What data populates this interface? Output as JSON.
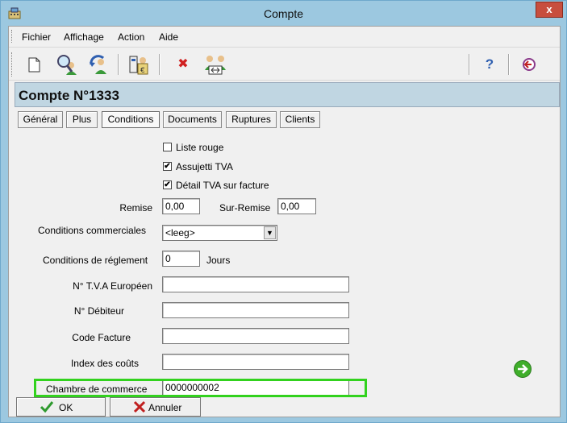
{
  "window": {
    "title": "Compte",
    "close_glyph": "x"
  },
  "menu": {
    "items": [
      "Fichier",
      "Affichage",
      "Action",
      "Aide"
    ]
  },
  "toolbar": {
    "icons": [
      "new-document-icon",
      "search-user-icon",
      "refresh-user-icon",
      "document-euro-icon",
      "delete-icon",
      "transfer-users-icon",
      "help-icon",
      "exit-icon"
    ],
    "help_glyph": "?",
    "delete_glyph": "✖"
  },
  "header": {
    "title": "Compte N°1333"
  },
  "tabs": [
    {
      "label": "Général"
    },
    {
      "label": "Plus"
    },
    {
      "label": "Conditions"
    },
    {
      "label": "Documents"
    },
    {
      "label": "Ruptures"
    },
    {
      "label": "Clients"
    }
  ],
  "active_tab": "Conditions",
  "form": {
    "liste_rouge": {
      "label": "Liste rouge",
      "checked": false
    },
    "assujetti_tva": {
      "label": "Assujetti TVA",
      "checked": true,
      "mark": "✔"
    },
    "detail_tva": {
      "label": "Détail TVA sur facture",
      "checked": true,
      "mark": "✔"
    },
    "remise": {
      "label": "Remise",
      "value": "0,00"
    },
    "sur_remise": {
      "label": "Sur-Remise",
      "value": "0,00"
    },
    "conditions_commerciales": {
      "label": "Conditions commerciales",
      "value": "<leeg>",
      "arrow": "▼"
    },
    "conditions_reglement": {
      "label": "Conditions de réglement",
      "value": "0",
      "unit": "Jours"
    },
    "tva_europeen": {
      "label": "N° T.V.A Européen",
      "value": ""
    },
    "debiteur": {
      "label": "N° Débiteur",
      "value": ""
    },
    "code_facture": {
      "label": "Code Facture",
      "value": ""
    },
    "index_couts": {
      "label": "Index des coûts",
      "value": ""
    },
    "chambre_commerce": {
      "label": "Chambre de commerce",
      "value": "0000000002"
    }
  },
  "buttons": {
    "ok": "OK",
    "cancel": "Annuler"
  },
  "colors": {
    "highlight": "#32d21e",
    "header_band": "#c0d6e2",
    "titlebar": "#9cc8e0"
  }
}
